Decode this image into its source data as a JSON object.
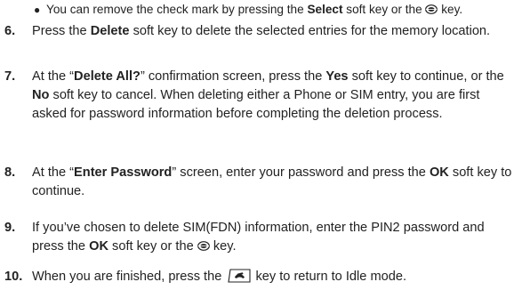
{
  "bullet": {
    "part1": "You can remove the check mark by pressing the ",
    "bold1": "Select",
    "part2": " soft key or the ",
    "part3": " key."
  },
  "steps": [
    {
      "num": "6.",
      "p1": "Press the ",
      "b1": "Delete",
      "p2": " soft key to delete the selected entries for the memory location."
    },
    {
      "num": "7.",
      "p1": "At the “",
      "b1": "Delete All?",
      "p2": "” confirmation screen, press the ",
      "b2": "Yes",
      "p3": " soft key to continue, or the ",
      "b3": "No",
      "p4": " soft key to cancel. When deleting either a Phone or SIM entry, you are first asked for password information before completing the deletion process."
    },
    {
      "num": "8.",
      "p1": "At the “",
      "b1": "Enter Password",
      "p2": "” screen, enter your password and press the ",
      "b2": "OK",
      "p3": " soft key to continue."
    },
    {
      "num": "9.",
      "p1": "If you’ve chosen to delete SIM(FDN) information, enter the PIN2 password and press the ",
      "b1": "OK",
      "p2": " soft key or the ",
      "p3": " key."
    },
    {
      "num": "10.",
      "p1": "When you are finished, press the ",
      "p2": " key to return to Idle mode."
    }
  ],
  "icons": {
    "ok_key": "ok-key-icon",
    "end_key": "end-key-icon"
  }
}
